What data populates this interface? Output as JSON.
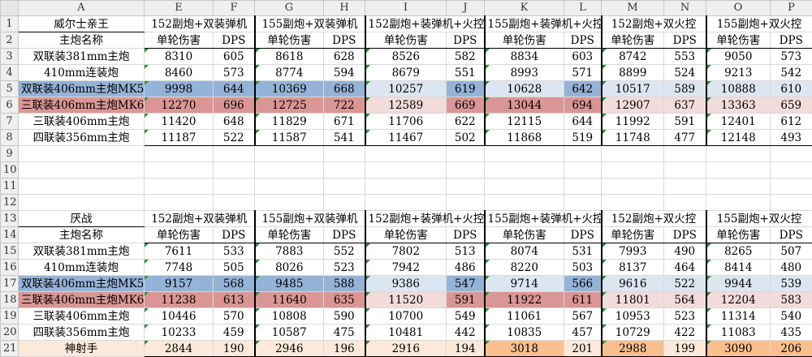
{
  "columns": [
    "A",
    "E",
    "F",
    "G",
    "H",
    "I",
    "J",
    "K",
    "L",
    "M",
    "N",
    "O",
    "P"
  ],
  "colors": {
    "blue_strong": "#95b3d7",
    "blue_light": "#dce6f1",
    "red_strong": "#da9694",
    "red_light": "#f2dcdb",
    "orange_strong": "#fabf8f",
    "orange_light": "#fde9d9"
  },
  "groups": [
    "152副炮+双装弹机",
    "155副炮+双装弹机",
    "152副炮+装弹机+火控",
    "155副炮+装弹机+火控",
    "152副炮+双火控",
    "155副炮+双火控"
  ],
  "subheaders": [
    "单轮伤害",
    "DPS"
  ],
  "table1": {
    "title": "威尔士亲王",
    "label_header": "主炮名称",
    "rows": [
      {
        "row": "3",
        "name": "双联装381mm主炮",
        "values": [
          "8310",
          "605",
          "8618",
          "628",
          "8526",
          "582",
          "8834",
          "603",
          "8742",
          "553",
          "9050",
          "573"
        ]
      },
      {
        "row": "4",
        "name": "410mm连装炮",
        "values": [
          "8460",
          "573",
          "8774",
          "594",
          "8679",
          "551",
          "8993",
          "571",
          "8899",
          "524",
          "9213",
          "542"
        ]
      },
      {
        "row": "5",
        "name": "双联装406mm主炮MK5",
        "values": [
          "9998",
          "644",
          "10369",
          "668",
          "10257",
          "619",
          "10628",
          "642",
          "10517",
          "589",
          "10888",
          "610"
        ]
      },
      {
        "row": "6",
        "name": "三联装406mm主炮MK6",
        "values": [
          "12270",
          "696",
          "12725",
          "722",
          "12589",
          "669",
          "13044",
          "694",
          "12907",
          "637",
          "13363",
          "659"
        ]
      },
      {
        "row": "7",
        "name": "三联装406mm主炮",
        "values": [
          "11420",
          "648",
          "11829",
          "671",
          "11706",
          "622",
          "12115",
          "644",
          "11992",
          "591",
          "12401",
          "612"
        ]
      },
      {
        "row": "8",
        "name": "四联装356mm主炮",
        "values": [
          "11187",
          "522",
          "11587",
          "541",
          "11467",
          "502",
          "11868",
          "519",
          "11748",
          "477",
          "12148",
          "493"
        ]
      }
    ]
  },
  "table2": {
    "title": "厌战",
    "label_header": "主炮名称",
    "rows": [
      {
        "row": "15",
        "name": "双联装381mm主炮",
        "values": [
          "7611",
          "533",
          "7883",
          "552",
          "7802",
          "513",
          "8074",
          "531",
          "7993",
          "490",
          "8265",
          "507"
        ]
      },
      {
        "row": "16",
        "name": "410mm连装炮",
        "values": [
          "7748",
          "505",
          "8026",
          "523",
          "7942",
          "486",
          "8220",
          "503",
          "8137",
          "464",
          "8414",
          "480"
        ]
      },
      {
        "row": "17",
        "name": "双联装406mm主炮MK5",
        "values": [
          "9157",
          "568",
          "9485",
          "588",
          "9386",
          "547",
          "9714",
          "566",
          "9616",
          "522",
          "9944",
          "539"
        ]
      },
      {
        "row": "18",
        "name": "三联装406mm主炮MK6",
        "values": [
          "11238",
          "613",
          "11640",
          "635",
          "11520",
          "591",
          "11922",
          "611",
          "11801",
          "564",
          "12204",
          "583"
        ]
      },
      {
        "row": "19",
        "name": "三联装406mm主炮",
        "values": [
          "10446",
          "570",
          "10808",
          "590",
          "10700",
          "549",
          "11061",
          "567",
          "10953",
          "523",
          "11314",
          "540"
        ]
      },
      {
        "row": "20",
        "name": "四联装356mm主炮",
        "values": [
          "10233",
          "459",
          "10587",
          "475",
          "10481",
          "442",
          "10835",
          "457",
          "10729",
          "422",
          "11083",
          "435"
        ]
      },
      {
        "row": "21",
        "name": "神射手",
        "values": [
          "2844",
          "190",
          "2946",
          "196",
          "2916",
          "194",
          "3018",
          "201",
          "2988",
          "199",
          "3090",
          "206"
        ]
      }
    ]
  },
  "empty_rows": [
    "9",
    "10",
    "11",
    "12"
  ]
}
